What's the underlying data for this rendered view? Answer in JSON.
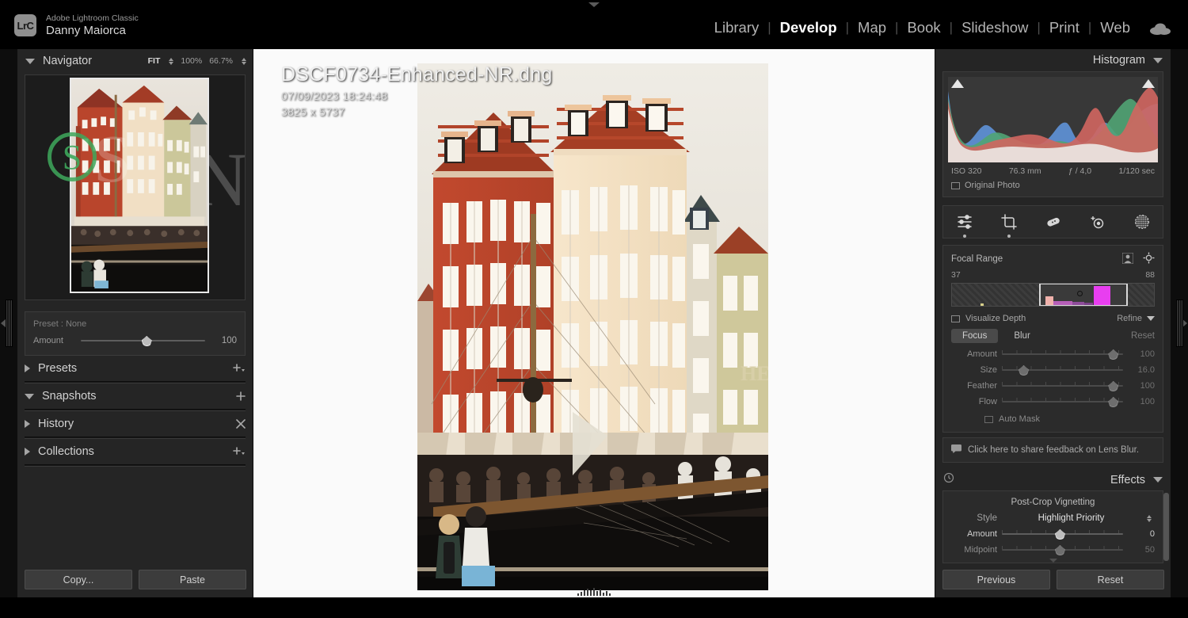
{
  "app": {
    "logo_text": "LrC",
    "product": "Adobe Lightroom Classic",
    "user": "Danny Maiorca"
  },
  "modules": {
    "items": [
      {
        "label": "Library",
        "active": false
      },
      {
        "label": "Develop",
        "active": true
      },
      {
        "label": "Map",
        "active": false
      },
      {
        "label": "Book",
        "active": false
      },
      {
        "label": "Slideshow",
        "active": false
      },
      {
        "label": "Print",
        "active": false
      },
      {
        "label": "Web",
        "active": false
      }
    ],
    "separator": "|",
    "cloud_icon": "cloud-icon"
  },
  "navigator": {
    "title": "Navigator",
    "fit": "FIT",
    "zoom_100": "100%",
    "zoom_custom": "66.7%",
    "watermark_circle": "S",
    "watermark_script": "S",
    "watermark_letter": "N"
  },
  "preset_strip": {
    "preset_label": "Preset : None",
    "amount_label": "Amount",
    "amount_value": "100"
  },
  "left_sections": [
    {
      "label": "Presets",
      "expanded": false,
      "action": "add-icon"
    },
    {
      "label": "Snapshots",
      "expanded": true,
      "action": "plus-icon"
    },
    {
      "label": "History",
      "expanded": false,
      "action": "clear-icon"
    },
    {
      "label": "Collections",
      "expanded": false,
      "action": "add-icon"
    }
  ],
  "left_buttons": {
    "copy": "Copy...",
    "paste": "Paste"
  },
  "photo": {
    "filename": "DSCF0734-Enhanced-NR.dng",
    "datetime": "07/09/2023 18:24:48",
    "dimensions": "3825 x 5737"
  },
  "histogram": {
    "title": "Histogram",
    "iso": "ISO 320",
    "focal_length": "76.3 mm",
    "aperture": "ƒ / 4,0",
    "shutter": "1/120 sec",
    "original_photo": "Original Photo"
  },
  "tools": [
    {
      "name": "edit-sliders-icon",
      "selected": true
    },
    {
      "name": "crop-icon",
      "selected": true
    },
    {
      "name": "healing-brush-icon",
      "selected": false
    },
    {
      "name": "red-eye-icon",
      "selected": false
    },
    {
      "name": "masking-icon",
      "selected": false
    }
  ],
  "lens_blur": {
    "focal_range_label": "Focal Range",
    "range_min": "37",
    "range_max": "88",
    "visualize_depth": "Visualize Depth",
    "refine": "Refine",
    "focus": "Focus",
    "blur": "Blur",
    "reset": "Reset",
    "sliders": [
      {
        "label": "Amount",
        "value": "100",
        "pos": 92
      },
      {
        "label": "Size",
        "value": "16.0",
        "pos": 18
      },
      {
        "label": "Feather",
        "value": "100",
        "pos": 92
      },
      {
        "label": "Flow",
        "value": "100",
        "pos": 92
      }
    ],
    "auto_mask": "Auto Mask",
    "feedback": "Click here to share feedback on Lens Blur."
  },
  "effects": {
    "title": "Effects",
    "subtitle": "Post-Crop Vignetting",
    "style_label": "Style",
    "style_value": "Highlight Priority",
    "amount_label": "Amount",
    "amount_value": "0",
    "midpoint_label": "Midpoint",
    "midpoint_value": "50"
  },
  "right_buttons": {
    "previous": "Previous",
    "reset": "Reset"
  },
  "colors": {
    "panel_bg": "#252525",
    "accent_magenta": "#e83ef0",
    "watermark_green": "#3ea85c"
  }
}
